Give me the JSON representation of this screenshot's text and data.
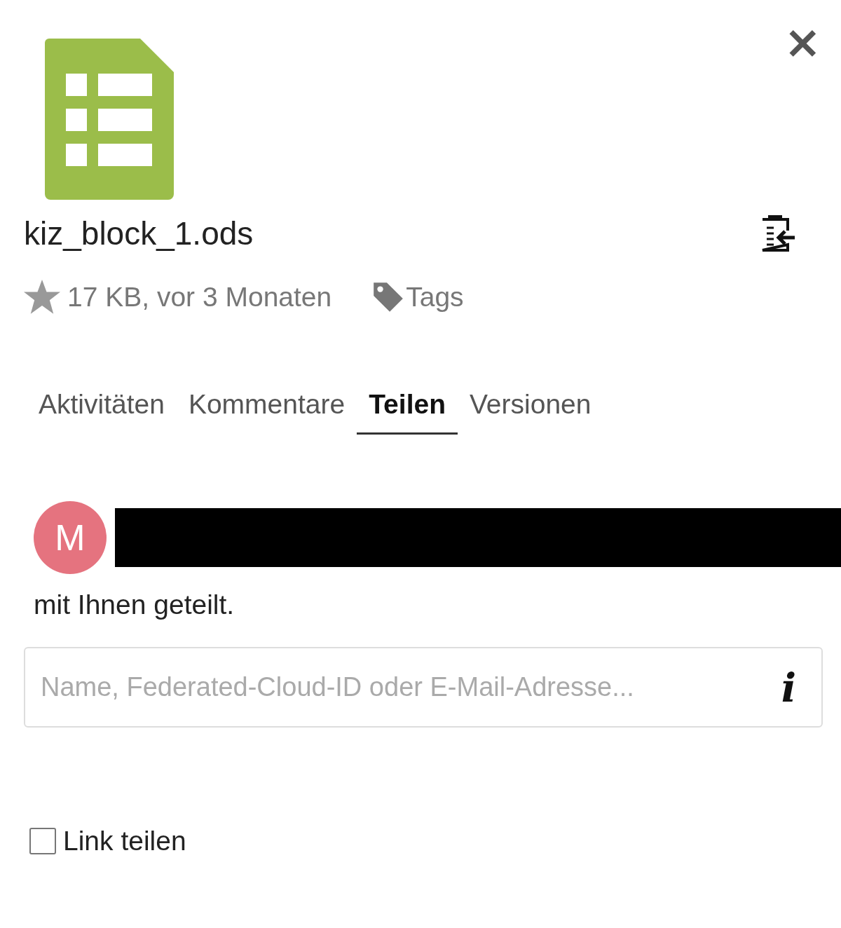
{
  "close_label": "×",
  "file": {
    "name": "kiz_block_1.ods",
    "favorite": false,
    "meta": "17 KB, vor 3 Monaten",
    "tags_label": "Tags"
  },
  "tabs": [
    {
      "label": "Aktivitäten",
      "selected": false
    },
    {
      "label": "Kommentare",
      "selected": false
    },
    {
      "label": "Teilen",
      "selected": true
    },
    {
      "label": "Versionen",
      "selected": false
    }
  ],
  "share": {
    "avatar_initial": "M",
    "shared_text": "mit Ihnen geteilt.",
    "search": {
      "placeholder": "Name, Federated-Cloud-ID oder E-Mail-Adresse..."
    },
    "info_label": "i"
  },
  "link_share": {
    "label": "Link teilen",
    "checked": false
  }
}
